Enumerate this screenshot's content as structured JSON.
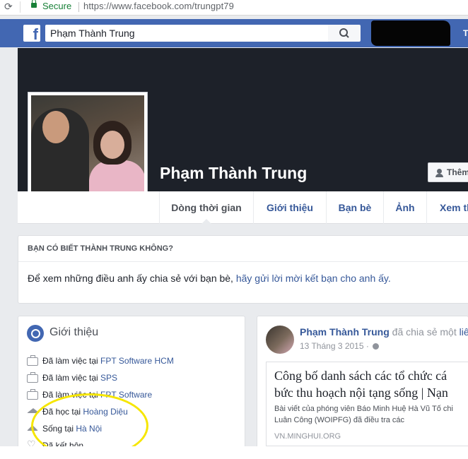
{
  "browser": {
    "secure_label": "Secure",
    "url": "https://www.facebook.com/trungpt79"
  },
  "topbar": {
    "logo_letter": "f",
    "search_value": "Phạm Thành Trung",
    "right_initial": "T"
  },
  "profile": {
    "name": "Phạm Thành Trung",
    "add_friend_label": "Thêm"
  },
  "tabs": [
    {
      "label": "Dòng thời gian",
      "active": true
    },
    {
      "label": "Giới thiệu"
    },
    {
      "label": "Bạn bè"
    },
    {
      "label": "Ảnh"
    },
    {
      "label": "Xem th"
    }
  ],
  "know_box": {
    "heading": "BẠN CÓ BIẾT THÀNH TRUNG KHÔNG?",
    "text": "Để xem những điều anh ấy chia sẻ với bạn bè, ",
    "link": "hãy gửi lời mời kết bạn cho anh ấy."
  },
  "intro": {
    "title": "Giới thiệu",
    "rows": [
      {
        "prefix": "Đã làm việc tại ",
        "link": "FPT Software HCM"
      },
      {
        "prefix": "Đã làm việc tại ",
        "link": "SPS"
      },
      {
        "prefix": "Đã làm việc tại ",
        "link": "FPT Software"
      },
      {
        "prefix": "Đã học tại ",
        "link": "Hoàng Diệu"
      },
      {
        "prefix": "Sống tại ",
        "link": "Hà Nội"
      },
      {
        "prefix": "Đã kết hôn",
        "link": ""
      }
    ]
  },
  "post": {
    "author": "Phạm Thành Trung",
    "action": " đã chia sẻ một ",
    "action_link": "liê",
    "date": "13 Tháng 3 2015 · ",
    "link_title_1": "Công bố danh sách các tổ chức cá",
    "link_title_2": "bức thu hoạch nội tạng sống | Nạn",
    "link_desc_1": "Bài viết của phóng viên Báo Minh Huệ Hà Vũ Tố chi",
    "link_desc_2": "Luân Công (WOIPFG) đã điều tra các",
    "link_domain": "VN.MINGHUI.ORG"
  },
  "colors": {
    "fb_blue": "#4267b2",
    "link": "#365899",
    "annotation": "#f6e600"
  }
}
